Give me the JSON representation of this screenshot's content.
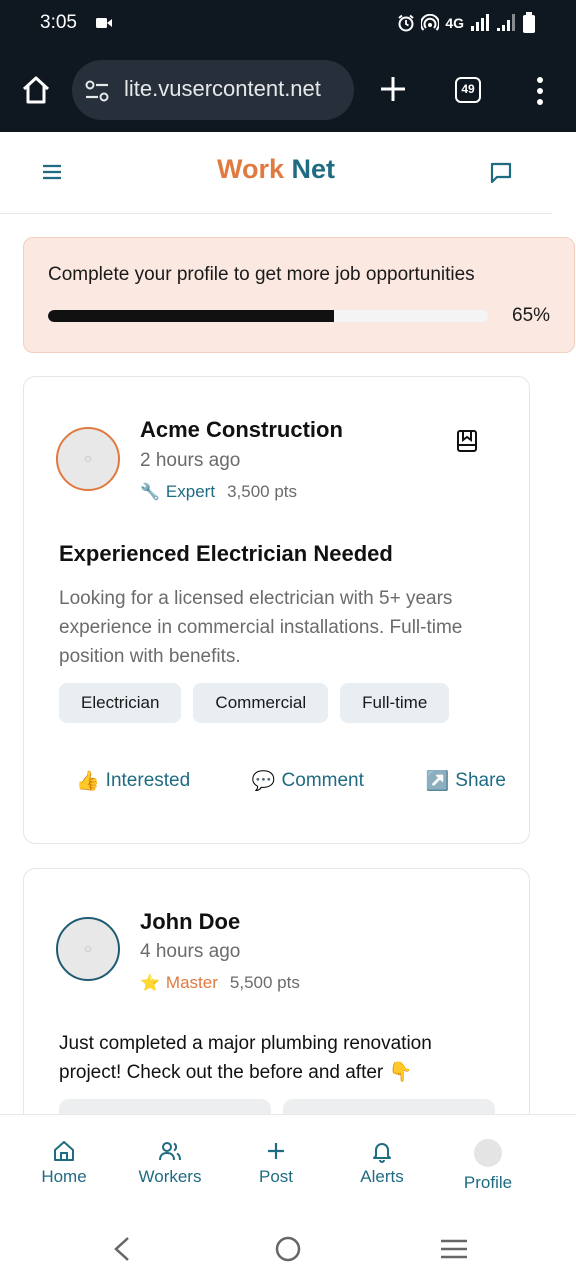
{
  "status_bar": {
    "time": "3:05",
    "network": "4G"
  },
  "browser": {
    "url": "lite.vusercontent.net",
    "tab_count": "49"
  },
  "header": {
    "brand_part1": "Work",
    "brand_part2": "Net"
  },
  "profile_banner": {
    "message": "Complete your profile to get more job opportunities",
    "percent_label": "65%",
    "progress": 0.65
  },
  "posts": [
    {
      "poster": "Acme Construction",
      "time": "2 hours ago",
      "badge_icon": "🔧",
      "badge": "Expert",
      "points": "3,500 pts",
      "title": "Experienced Electrician Needed",
      "description": "Looking for a licensed electrician with 5+ years experience in commercial installations. Full-time position with benefits.",
      "tags": [
        "Electrician",
        "Commercial",
        "Full-time"
      ],
      "actions": [
        {
          "icon": "👍",
          "label": "Interested"
        },
        {
          "icon": "💬",
          "label": "Comment"
        },
        {
          "icon": "↗️",
          "label": "Share"
        }
      ]
    },
    {
      "poster": "John Doe",
      "time": "4 hours ago",
      "badge_icon": "⭐",
      "badge": "Master",
      "points": "5,500 pts",
      "text": "Just completed a major plumbing renovation project! Check out the before and after 👇"
    }
  ],
  "bottom_nav": [
    {
      "icon": "home-icon",
      "label": "Home"
    },
    {
      "icon": "users-icon",
      "label": "Workers"
    },
    {
      "icon": "plus-icon",
      "label": "Post"
    },
    {
      "icon": "bell-icon",
      "label": "Alerts"
    },
    {
      "icon": "avatar",
      "label": "Profile"
    }
  ],
  "colors": {
    "brand_orange": "#e07a40",
    "brand_teal": "#1f6b82",
    "banner_bg": "#fbe8e1"
  }
}
